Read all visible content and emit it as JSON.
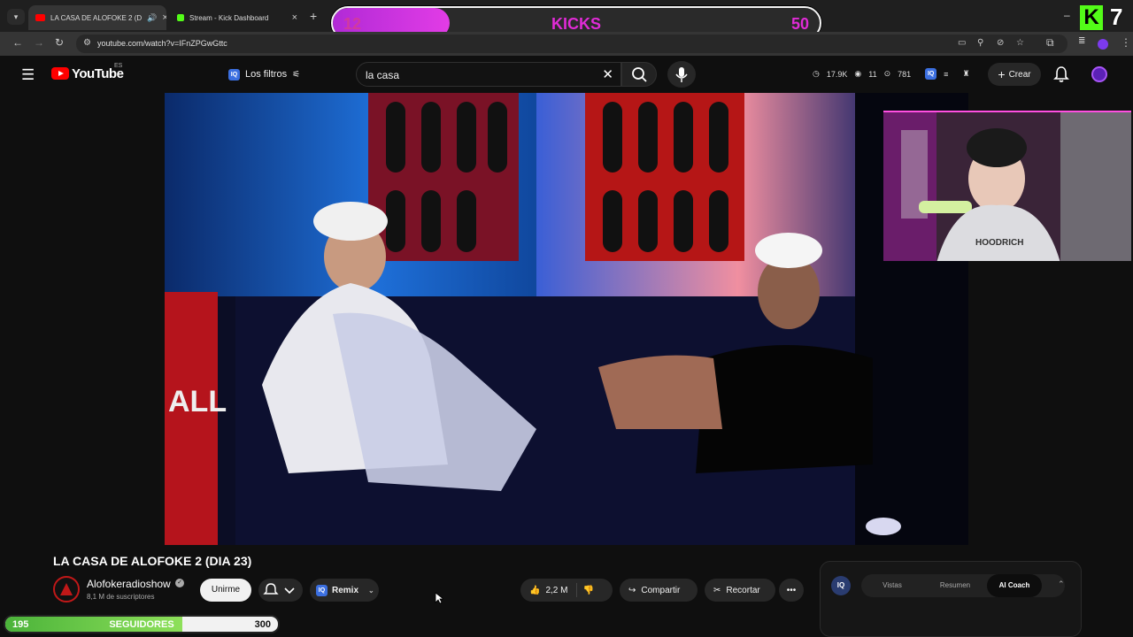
{
  "browser": {
    "tabs": [
      {
        "title": "LA CASA DE ALOFOKE 2 (D",
        "active": true
      },
      {
        "title": "Stream - Kick Dashboard",
        "active": false
      }
    ],
    "url": "youtube.com/watch?v=IFnZPGwGttc"
  },
  "overlay": {
    "kicks": {
      "label": "KICKS",
      "current": "12",
      "goal": "50",
      "fraction": 0.24
    },
    "kick_count": "7",
    "followers": {
      "label": "SEGUIDORES",
      "current": "195",
      "goal": "300",
      "fraction": 0.65
    }
  },
  "yt": {
    "logo_text": "YouTube",
    "country": "ES",
    "filters_label": "Los filtros",
    "search_value": "la casa",
    "stats": {
      "views": "17.9K",
      "count1": "11",
      "count2": "781"
    },
    "create_label": "Crear"
  },
  "video": {
    "title": "LA CASA DE ALOFOKE 2 (DIA 23)",
    "channel": "Alofokeradioshow",
    "subscribers": "8,1 M de suscriptores",
    "join_label": "Unirme",
    "remix_label": "Remix",
    "likes": "2,2 M",
    "share_label": "Compartir",
    "clip_label": "Recortar",
    "wall_text": "ALL"
  },
  "ai_panel": {
    "badge": "IQ",
    "tabs": [
      "Vistas",
      "Resumen",
      "AI Coach"
    ],
    "active_tab": "AI Coach"
  },
  "colors": {
    "kick_green": "#53fc18",
    "kicks_pink": "#e02bd6",
    "yt_red": "#ff0000",
    "followers_green": "#6ccf45"
  }
}
